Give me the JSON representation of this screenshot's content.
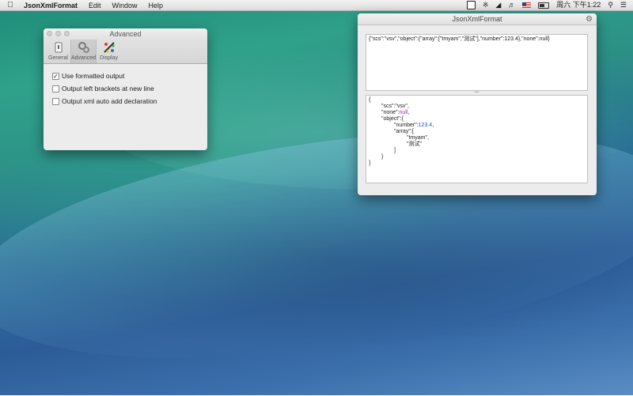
{
  "menubar": {
    "app_name": "JsonXmlFormat",
    "menus": [
      "Edit",
      "Window",
      "Help"
    ],
    "clock": "周六 下午1:22"
  },
  "prefs": {
    "title": "Advanced",
    "tabs": [
      {
        "label": "General",
        "icon": "switch-icon"
      },
      {
        "label": "Advanced",
        "icon": "advanced-gears-icon"
      },
      {
        "label": "Display",
        "icon": "brush-colors-icon"
      }
    ],
    "options": [
      {
        "label": "Use formatted output",
        "checked": true
      },
      {
        "label": "Output left brackets at new line",
        "checked": false
      },
      {
        "label": "Output xml auto add declaration",
        "checked": false
      }
    ]
  },
  "main": {
    "title": "JsonXmlFormat",
    "input_text": "{\"scs\":\"vsv\",\"object\":{\"array\":[\"tmyam\",\"测试\"],\"number\":123.4},\"none\":null}",
    "output_lines": [
      {
        "indent": 0,
        "key": "",
        "value": "{",
        "type": "punct"
      },
      {
        "indent": 1,
        "key": "\"scs\":",
        "value": "\"vsv\",",
        "type": "string"
      },
      {
        "indent": 1,
        "key": "\"none\":",
        "value": "null",
        "type": "null",
        "after": ","
      },
      {
        "indent": 1,
        "key": "\"object\":",
        "value": "{",
        "type": "punct"
      },
      {
        "indent": 2,
        "key": "\"number\":",
        "value": "123.4",
        "type": "number",
        "after": ","
      },
      {
        "indent": 2,
        "key": "\"array\":",
        "value": "[",
        "type": "punct"
      },
      {
        "indent": 3,
        "key": "",
        "value": "\"tmyam\",",
        "type": "string"
      },
      {
        "indent": 3,
        "key": "",
        "value": "\"测试\"",
        "type": "string"
      },
      {
        "indent": 2,
        "key": "",
        "value": "]",
        "type": "punct"
      },
      {
        "indent": 1,
        "key": "",
        "value": "}",
        "type": "punct"
      },
      {
        "indent": 0,
        "key": "",
        "value": "}",
        "type": "punct"
      }
    ],
    "colors": {
      "number": "#2b50c8",
      "null": "#b01ad0"
    }
  }
}
